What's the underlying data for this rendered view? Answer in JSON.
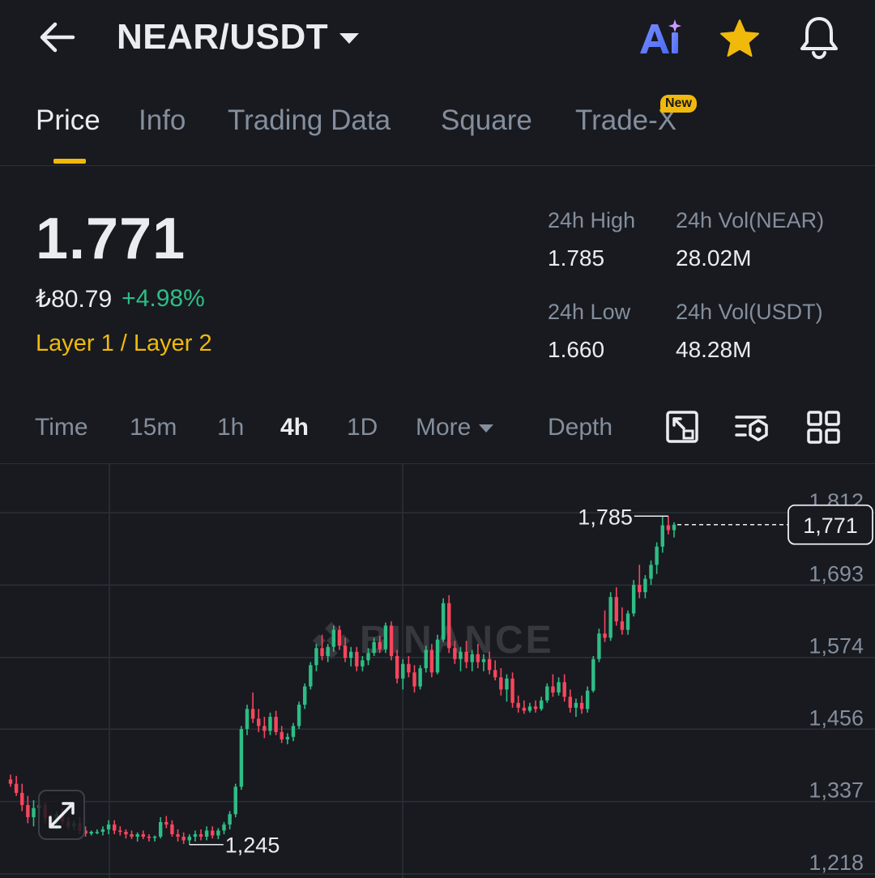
{
  "header": {
    "pair": "NEAR/USDT",
    "icons": {
      "back": "back-arrow-icon",
      "ai": "ai-icon",
      "favorite": "star-icon",
      "alert": "bell-icon"
    },
    "ai_label": "Ai"
  },
  "tabs": [
    {
      "label": "Price",
      "active": true
    },
    {
      "label": "Info"
    },
    {
      "label": "Trading Data"
    },
    {
      "label": "Square"
    },
    {
      "label": "Trade-X",
      "badge": "New"
    }
  ],
  "price": {
    "last": "1.771",
    "fiat": "₺80.79",
    "change": "+4.98%",
    "category": "Layer 1 / Layer 2"
  },
  "stats": {
    "high_label": "24h High",
    "high": "1.785",
    "low_label": "24h Low",
    "low": "1.660",
    "vol_base_label": "24h Vol(NEAR)",
    "vol_base": "28.02M",
    "vol_quote_label": "24h Vol(USDT)",
    "vol_quote": "48.28M"
  },
  "intervals": [
    "Time",
    "15m",
    "1h",
    "4h",
    "1D",
    "More",
    "Depth"
  ],
  "active_interval": "4h",
  "toolbar_icons": [
    "chart-settings-icon",
    "indicator-settings-icon",
    "grid-layout-icon"
  ],
  "colors": {
    "up": "#2ebd85",
    "down": "#f6465d",
    "accent": "#f0b90b",
    "background": "#181a20"
  },
  "watermark": "BINANCE",
  "chart_data": {
    "type": "candlestick",
    "y_ticks": [
      "1,812",
      "1,693",
      "1,574",
      "1,456",
      "1,337",
      "1,218"
    ],
    "ylim": [
      1218,
      1812
    ],
    "current_price_label": "1,771",
    "current_price": 1771,
    "high_marker": "1,785",
    "high_value": 1785,
    "low_marker": "1,245",
    "low_value": 1245,
    "candles": [
      [
        1352,
        1360,
        1340,
        1345
      ],
      [
        1345,
        1358,
        1325,
        1330
      ],
      [
        1330,
        1345,
        1300,
        1310
      ],
      [
        1310,
        1325,
        1280,
        1290
      ],
      [
        1290,
        1318,
        1275,
        1305
      ],
      [
        1305,
        1320,
        1295,
        1310
      ],
      [
        1310,
        1315,
        1280,
        1288
      ],
      [
        1288,
        1295,
        1272,
        1280
      ],
      [
        1280,
        1300,
        1270,
        1295
      ],
      [
        1295,
        1305,
        1278,
        1283
      ],
      [
        1283,
        1290,
        1270,
        1275
      ],
      [
        1275,
        1285,
        1268,
        1280
      ],
      [
        1280,
        1290,
        1262,
        1268
      ],
      [
        1268,
        1275,
        1258,
        1263
      ],
      [
        1263,
        1268,
        1260,
        1266
      ],
      [
        1266,
        1270,
        1262,
        1266
      ],
      [
        1266,
        1275,
        1260,
        1270
      ],
      [
        1270,
        1285,
        1262,
        1278
      ],
      [
        1278,
        1285,
        1262,
        1268
      ],
      [
        1268,
        1275,
        1260,
        1266
      ],
      [
        1266,
        1270,
        1255,
        1262
      ],
      [
        1262,
        1268,
        1254,
        1258
      ],
      [
        1258,
        1265,
        1250,
        1262
      ],
      [
        1262,
        1268,
        1254,
        1258
      ],
      [
        1258,
        1262,
        1250,
        1256
      ],
      [
        1256,
        1260,
        1250,
        1258
      ],
      [
        1258,
        1290,
        1255,
        1282
      ],
      [
        1282,
        1292,
        1272,
        1278
      ],
      [
        1278,
        1285,
        1258,
        1262
      ],
      [
        1262,
        1270,
        1250,
        1258
      ],
      [
        1258,
        1265,
        1246,
        1252
      ],
      [
        1252,
        1262,
        1245,
        1258
      ],
      [
        1258,
        1268,
        1250,
        1262
      ],
      [
        1262,
        1270,
        1252,
        1258
      ],
      [
        1258,
        1275,
        1252,
        1268
      ],
      [
        1268,
        1275,
        1255,
        1260
      ],
      [
        1260,
        1272,
        1254,
        1268
      ],
      [
        1268,
        1282,
        1262,
        1278
      ],
      [
        1278,
        1300,
        1270,
        1295
      ],
      [
        1295,
        1345,
        1290,
        1340
      ],
      [
        1340,
        1440,
        1335,
        1435
      ],
      [
        1435,
        1475,
        1425,
        1468
      ],
      [
        1468,
        1495,
        1445,
        1452
      ],
      [
        1452,
        1468,
        1430,
        1440
      ],
      [
        1440,
        1455,
        1420,
        1432
      ],
      [
        1432,
        1462,
        1425,
        1455
      ],
      [
        1455,
        1465,
        1425,
        1430
      ],
      [
        1430,
        1440,
        1412,
        1418
      ],
      [
        1418,
        1428,
        1410,
        1422
      ],
      [
        1422,
        1445,
        1415,
        1440
      ],
      [
        1440,
        1480,
        1435,
        1475
      ],
      [
        1475,
        1510,
        1468,
        1505
      ],
      [
        1505,
        1545,
        1500,
        1540
      ],
      [
        1540,
        1575,
        1530,
        1568
      ],
      [
        1568,
        1590,
        1548,
        1555
      ],
      [
        1555,
        1575,
        1545,
        1570
      ],
      [
        1570,
        1605,
        1562,
        1598
      ],
      [
        1598,
        1605,
        1565,
        1572
      ],
      [
        1572,
        1585,
        1545,
        1552
      ],
      [
        1552,
        1570,
        1538,
        1562
      ],
      [
        1562,
        1570,
        1530,
        1538
      ],
      [
        1538,
        1555,
        1530,
        1548
      ],
      [
        1548,
        1568,
        1540,
        1560
      ],
      [
        1560,
        1585,
        1555,
        1578
      ],
      [
        1578,
        1588,
        1560,
        1566
      ],
      [
        1566,
        1610,
        1560,
        1605
      ],
      [
        1605,
        1612,
        1548,
        1555
      ],
      [
        1555,
        1565,
        1510,
        1518
      ],
      [
        1518,
        1550,
        1500,
        1542
      ],
      [
        1542,
        1555,
        1520,
        1528
      ],
      [
        1528,
        1540,
        1495,
        1505
      ],
      [
        1505,
        1540,
        1500,
        1535
      ],
      [
        1535,
        1572,
        1528,
        1565
      ],
      [
        1565,
        1575,
        1520,
        1528
      ],
      [
        1528,
        1590,
        1525,
        1582
      ],
      [
        1582,
        1650,
        1578,
        1642
      ],
      [
        1642,
        1655,
        1560,
        1568
      ],
      [
        1568,
        1580,
        1542,
        1550
      ],
      [
        1550,
        1570,
        1530,
        1562
      ],
      [
        1562,
        1580,
        1535,
        1545
      ],
      [
        1545,
        1565,
        1530,
        1558
      ],
      [
        1558,
        1575,
        1535,
        1545
      ],
      [
        1545,
        1558,
        1530,
        1550
      ],
      [
        1550,
        1562,
        1525,
        1532
      ],
      [
        1532,
        1548,
        1515,
        1520
      ],
      [
        1520,
        1535,
        1490,
        1500
      ],
      [
        1500,
        1525,
        1480,
        1518
      ],
      [
        1518,
        1528,
        1470,
        1478
      ],
      [
        1478,
        1490,
        1462,
        1470
      ],
      [
        1470,
        1482,
        1460,
        1465
      ],
      [
        1465,
        1478,
        1462,
        1472
      ],
      [
        1472,
        1482,
        1462,
        1468
      ],
      [
        1468,
        1488,
        1465,
        1482
      ],
      [
        1482,
        1510,
        1478,
        1505
      ],
      [
        1505,
        1525,
        1488,
        1495
      ],
      [
        1495,
        1520,
        1490,
        1512
      ],
      [
        1512,
        1525,
        1480,
        1488
      ],
      [
        1488,
        1500,
        1462,
        1470
      ],
      [
        1470,
        1485,
        1455,
        1478
      ],
      [
        1478,
        1490,
        1460,
        1468
      ],
      [
        1468,
        1505,
        1462,
        1498
      ],
      [
        1498,
        1555,
        1495,
        1550
      ],
      [
        1550,
        1600,
        1545,
        1592
      ],
      [
        1592,
        1630,
        1578,
        1585
      ],
      [
        1585,
        1660,
        1580,
        1652
      ],
      [
        1652,
        1668,
        1605,
        1612
      ],
      [
        1612,
        1635,
        1590,
        1598
      ],
      [
        1598,
        1630,
        1590,
        1625
      ],
      [
        1625,
        1680,
        1620,
        1672
      ],
      [
        1672,
        1705,
        1650,
        1660
      ],
      [
        1660,
        1688,
        1650,
        1682
      ],
      [
        1682,
        1712,
        1672,
        1705
      ],
      [
        1705,
        1742,
        1690,
        1735
      ],
      [
        1735,
        1785,
        1725,
        1770
      ],
      [
        1770,
        1785,
        1755,
        1762
      ],
      [
        1762,
        1775,
        1750,
        1771
      ]
    ]
  }
}
